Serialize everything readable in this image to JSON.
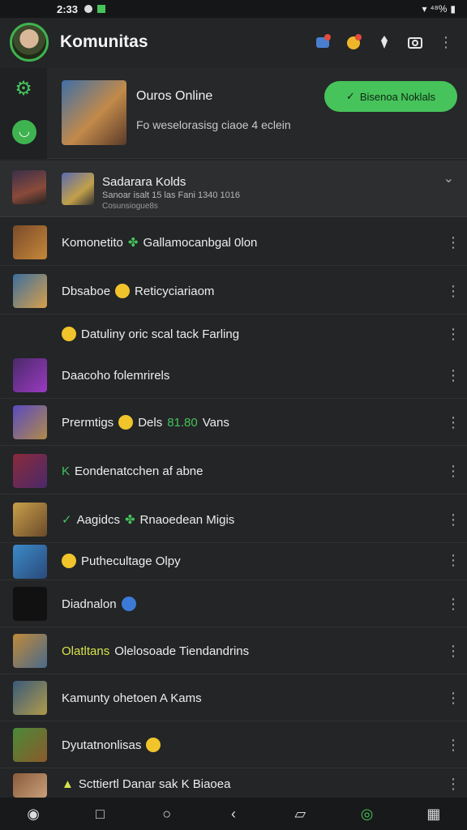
{
  "status_bar": {
    "time": "2:33",
    "right_text": "⁴⁸%"
  },
  "app_bar": {
    "title": "Komunitas"
  },
  "featured": {
    "name": "Ouros Online",
    "description": "Fo weselorasisg ciaoe 4 eclein",
    "join_label": "Bisenoa Noklals"
  },
  "expanded": {
    "title": "Sadarara Kolds",
    "sub1": "Sanoar isalt 15 las Fani 1340 1016",
    "sub2": "Cosunsiogue8s"
  },
  "rows": [
    {
      "pre": "",
      "text": "Komonetito",
      "mid_icon": "clover",
      "tail": "Gallamocanbgal 0lon"
    },
    {
      "pre": "",
      "text": "Dbsaboe",
      "mid_icon": "smile",
      "tail": "Reticyciariaom"
    },
    {
      "pre": "emoji",
      "text": "Datuliny oric scal tack Farling",
      "mid_icon": "",
      "tail": ""
    },
    {
      "pre": "",
      "text": "Daacoho folemrirels",
      "mid_icon": "",
      "tail": ""
    },
    {
      "pre": "",
      "text": "Prermtigs",
      "mid_icon": "smile",
      "tail": "Dels",
      "accent": "81.80",
      "tail2": "Vans"
    },
    {
      "pre": "K",
      "text": "Eondenatcchen af abne",
      "mid_icon": "",
      "tail": ""
    },
    {
      "pre": "check",
      "text": "Aagidcs",
      "mid_icon": "clover",
      "tail": "Rnaoedean Migis"
    },
    {
      "pre": "emoji",
      "text": "Puthecultage Olpy",
      "mid_icon": "",
      "tail": ""
    },
    {
      "pre": "",
      "text": "Diadnalon",
      "mid_icon": "globe",
      "tail": ""
    },
    {
      "pre": "",
      "text": "Olatltans",
      "accent_first": true,
      "tail": "Olelosoade Tiendandrins"
    },
    {
      "pre": "",
      "text": "Kamunty ohetoen A Kams",
      "mid_icon": "",
      "tail": ""
    },
    {
      "pre": "",
      "text": "Dyutatnonlisas",
      "mid_icon": "smile",
      "tail": ""
    },
    {
      "pre": "warn",
      "text": "Scttiertl Danar sak K Biaoea",
      "mid_icon": "",
      "tail": ""
    }
  ],
  "colors": {
    "accent": "#46c35a",
    "bg": "#232527",
    "yellow": "#d9e34a"
  },
  "icons": [
    "gear-icon",
    "chat-icon",
    "camera-icon",
    "more-vert-icon",
    "chevron-down-icon"
  ]
}
